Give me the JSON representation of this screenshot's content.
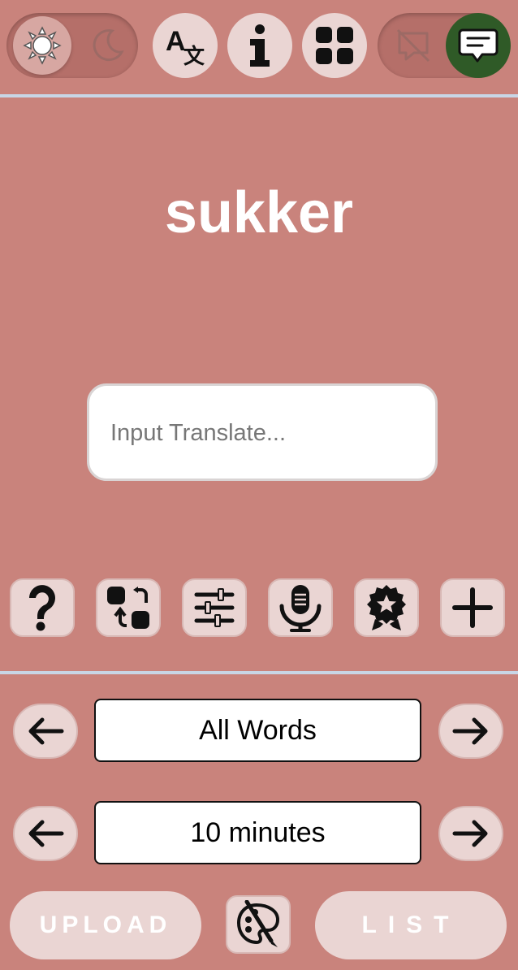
{
  "header": {
    "theme_toggle": {
      "light_icon": "sun-icon",
      "dark_icon": "moon-icon",
      "active": "light"
    },
    "buttons": [
      {
        "icon": "translate-icon"
      },
      {
        "icon": "info-icon"
      },
      {
        "icon": "grid-icon"
      }
    ],
    "chat_toggle": {
      "off_icon": "chat-off-icon",
      "on_icon": "chat-icon",
      "active": "on",
      "accent": "#2f5a27"
    }
  },
  "main": {
    "word": "sukker",
    "input": {
      "placeholder": "Input Translate...",
      "value": ""
    }
  },
  "toolbar": [
    {
      "icon": "question-icon"
    },
    {
      "icon": "swap-icon"
    },
    {
      "icon": "sliders-icon"
    },
    {
      "icon": "microphone-icon"
    },
    {
      "icon": "badge-icon"
    },
    {
      "icon": "plus-icon"
    }
  ],
  "selectors": {
    "word_set": {
      "value": "All Words"
    },
    "duration": {
      "value": "10 minutes"
    }
  },
  "footer": {
    "upload_label": "UPLOAD",
    "list_label": "LIST",
    "palette_icon": "palette-icon"
  },
  "colors": {
    "background": "#c9837c",
    "button": "#ead5d3",
    "accent": "#2f5a27",
    "divider": "#c8d6e6"
  }
}
